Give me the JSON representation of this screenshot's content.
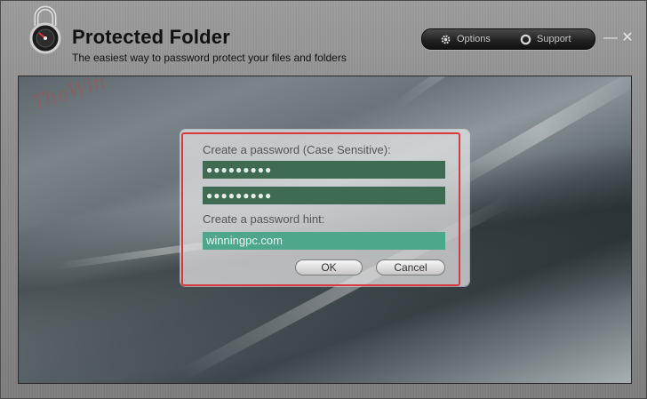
{
  "app": {
    "title": "Protected Folder",
    "subtitle": "The easiest way to password protect your files and folders"
  },
  "toolbar": {
    "options_label": "Options",
    "support_label": "Support",
    "minimize_glyph": "—",
    "close_glyph": "✕"
  },
  "dialog": {
    "password_label": "Create a password (Case Sensitive):",
    "password_value": "●●●●●●●●●",
    "confirm_value": "●●●●●●●●●",
    "hint_label": "Create a password hint:",
    "hint_value": "winningpc.com",
    "ok_label": "OK",
    "cancel_label": "Cancel"
  },
  "colors": {
    "field_green": "#3f6b53",
    "hint_teal": "#4ea78c",
    "highlight_red": "#d9363e"
  },
  "icons": [
    "padlock-icon",
    "gear-icon",
    "support-icon",
    "minimize-icon",
    "close-icon"
  ]
}
